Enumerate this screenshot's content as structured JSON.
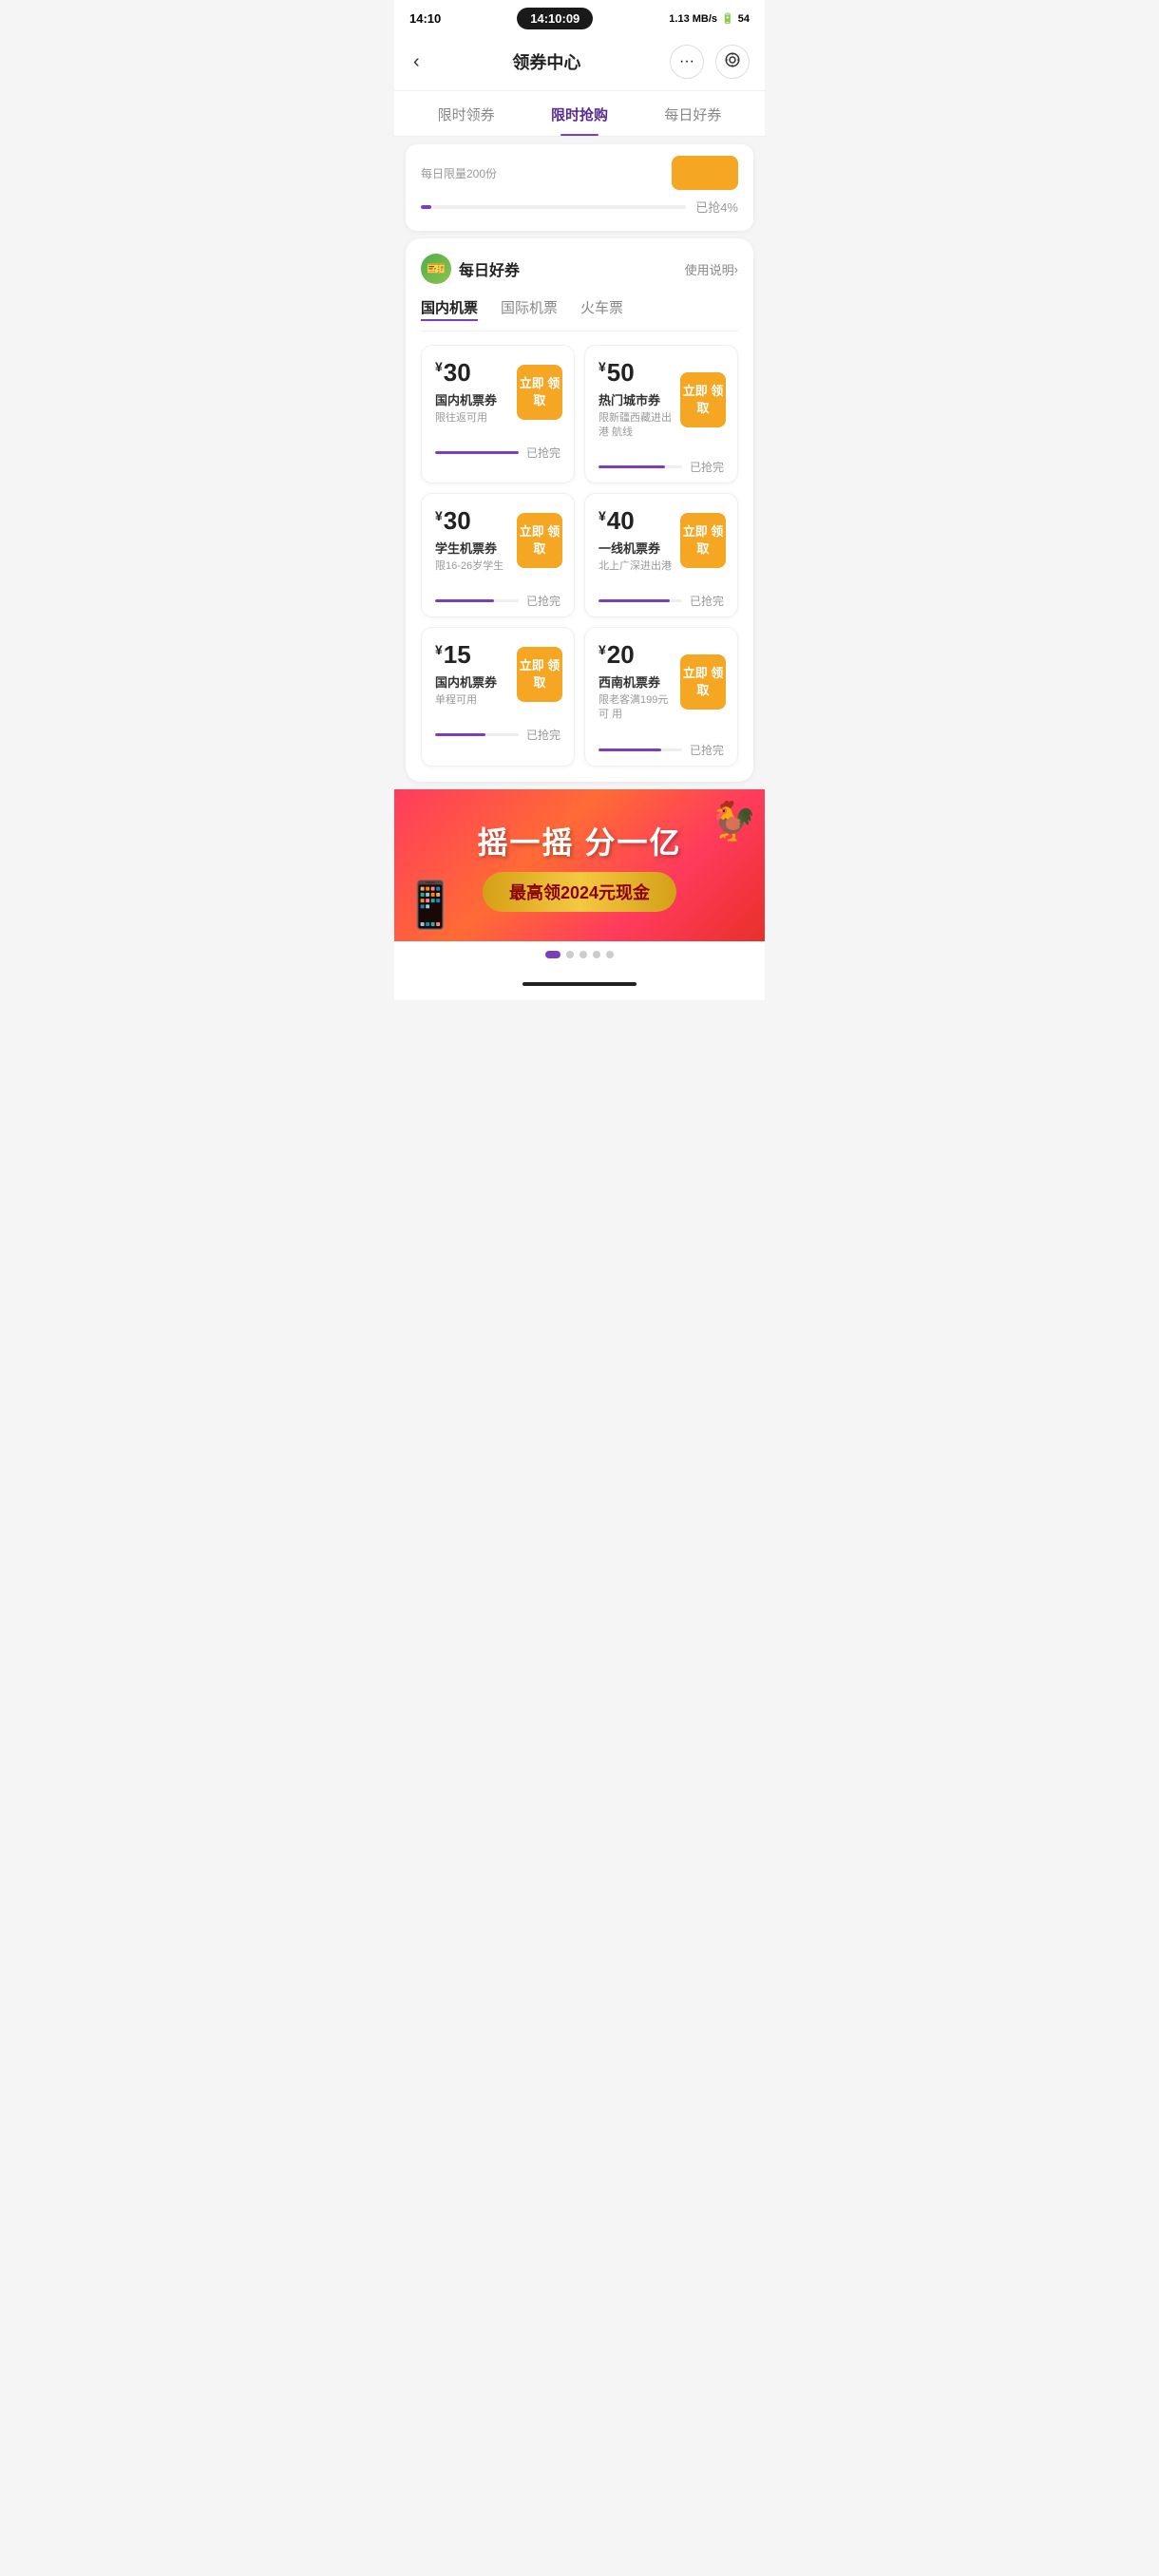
{
  "statusBar": {
    "timeLeft": "14:10",
    "timeCenter": "14:10:09",
    "network": "1.13 MB/s",
    "battery": "54"
  },
  "header": {
    "title": "领券中心",
    "menuLabel": "···",
    "scanLabel": "⊙"
  },
  "tabs": [
    {
      "id": "tab1",
      "label": "限时领券",
      "active": false
    },
    {
      "id": "tab2",
      "label": "限时抢购",
      "active": true
    },
    {
      "id": "tab3",
      "label": "每日好券",
      "active": false
    }
  ],
  "partialCoupon": {
    "limitText": "每日限量200份",
    "progressPercent": 4,
    "progressLabel": "已抢4%"
  },
  "dailySection": {
    "title": "每日好券",
    "linkText": "使用说明",
    "subTabs": [
      {
        "label": "国内机票",
        "active": true
      },
      {
        "label": "国际机票",
        "active": false
      },
      {
        "label": "火车票",
        "active": false
      }
    ],
    "coupons": [
      {
        "amount": "30",
        "name": "国内机票券",
        "desc": "限往返可用",
        "btnText": "立即\n领取",
        "progressPercent": 100,
        "status": "已抢完"
      },
      {
        "amount": "50",
        "name": "热门城市券",
        "desc": "限新疆西藏进出港\n航线",
        "btnText": "立即\n领取",
        "progressPercent": 80,
        "status": "已抢完"
      },
      {
        "amount": "30",
        "name": "学生机票券",
        "desc": "限16-26岁学生",
        "btnText": "立即\n领取",
        "progressPercent": 70,
        "status": "已抢完"
      },
      {
        "amount": "40",
        "name": "一线机票券",
        "desc": "北上广深进出港",
        "btnText": "立即\n领取",
        "progressPercent": 85,
        "status": "已抢完"
      },
      {
        "amount": "15",
        "name": "国内机票券",
        "desc": "单程可用",
        "btnText": "立即\n领取",
        "progressPercent": 60,
        "status": "已抢完"
      },
      {
        "amount": "20",
        "name": "西南机票券",
        "desc": "限老客满199元可\n用",
        "btnText": "立即\n领取",
        "progressPercent": 75,
        "status": "已抢完"
      }
    ]
  },
  "banner": {
    "title": "摇一摇 分一亿",
    "subtitle": "最高领2024元现金"
  },
  "pageDots": [
    {
      "active": true
    },
    {
      "active": false
    },
    {
      "active": false
    },
    {
      "active": false
    },
    {
      "active": false
    }
  ]
}
